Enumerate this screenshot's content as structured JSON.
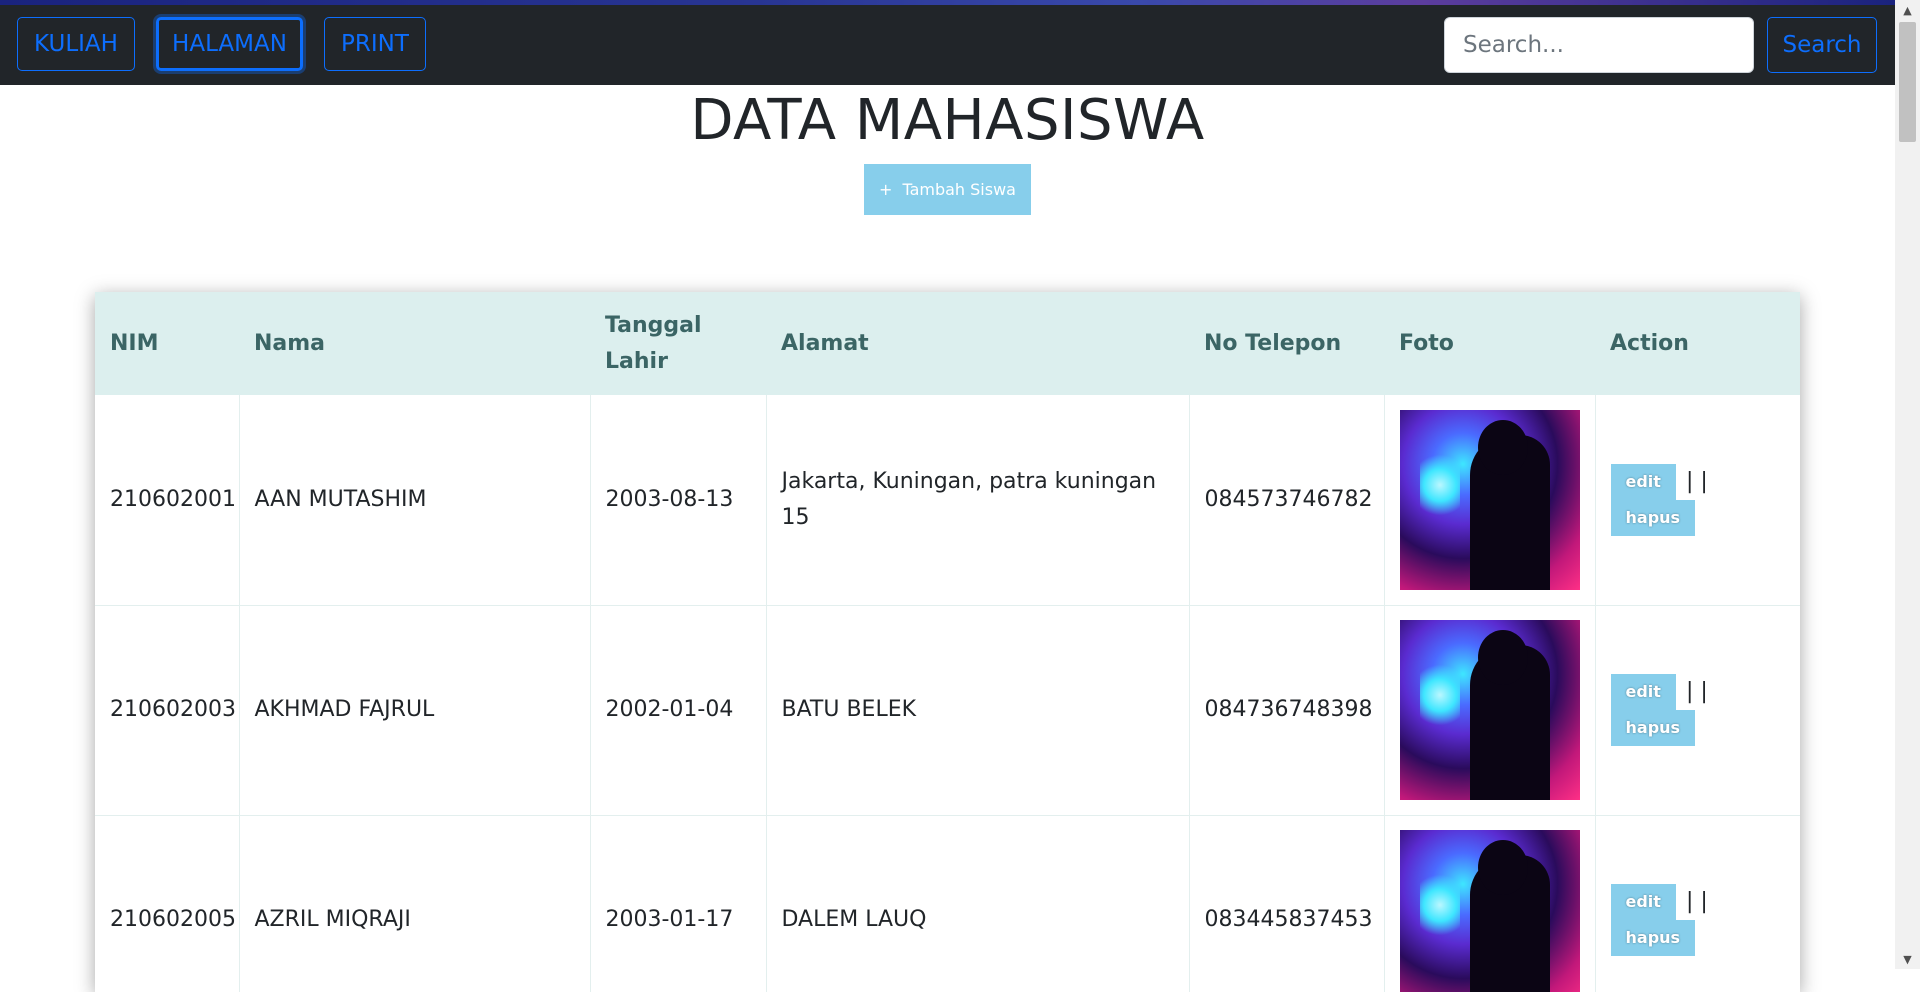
{
  "navbar": {
    "buttons": [
      {
        "label": "KULIAH"
      },
      {
        "label": "HALAMAN"
      },
      {
        "label": "PRINT"
      }
    ],
    "search_placeholder": "Search...",
    "search_button": "Search"
  },
  "page": {
    "title": "DATA MAHASISWA",
    "add_button_icon": "+",
    "add_button_label": "Tambah Siswa"
  },
  "table": {
    "headers": {
      "nim": "NIM",
      "nama": "Nama",
      "tanggal_lahir": "Tanggal Lahir",
      "alamat": "Alamat",
      "no_telepon": "No Telepon",
      "foto": "Foto",
      "action": "Action"
    },
    "rows": [
      {
        "nim": "210602001",
        "nama": "AAN MUTASHIM",
        "tanggal_lahir": "2003-08-13",
        "alamat": "Jakarta, Kuningan, patra kuningan 15",
        "no_telepon": "084573746782",
        "foto_icon": "profile-photo",
        "edit": "edit",
        "separator": "| |",
        "hapus": "hapus"
      },
      {
        "nim": "210602003",
        "nama": "AKHMAD FAJRUL",
        "tanggal_lahir": "2002-01-04",
        "alamat": "BATU BELEK",
        "no_telepon": "084736748398",
        "foto_icon": "profile-photo",
        "edit": "edit",
        "separator": "| |",
        "hapus": "hapus"
      },
      {
        "nim": "210602005",
        "nama": "AZRIL MIQRAJI",
        "tanggal_lahir": "2003-01-17",
        "alamat": "DALEM LAUQ",
        "no_telepon": "083445837453",
        "foto_icon": "profile-photo",
        "edit": "edit",
        "separator": "| |",
        "hapus": "hapus"
      }
    ]
  },
  "colors": {
    "navbar_bg": "#212529",
    "nav_accent": "#0d6efd",
    "button_bg": "#87ceeb",
    "table_header_bg": "#dcefee"
  }
}
